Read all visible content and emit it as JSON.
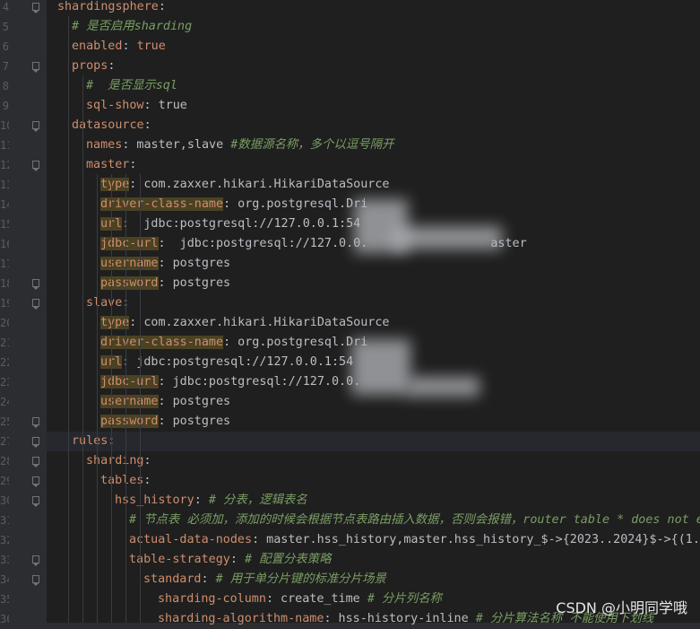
{
  "editor": {
    "lines": [
      {
        "num": "4",
        "fold": true,
        "indent": 0,
        "parts": [
          {
            "t": "shardingsphere",
            "c": "k"
          },
          {
            "t": ":",
            "c": "v"
          }
        ]
      },
      {
        "num": "5",
        "fold": false,
        "indent": 1,
        "parts": [
          {
            "t": "# 是否启用sharding",
            "c": "c"
          }
        ]
      },
      {
        "num": "6",
        "fold": false,
        "indent": 1,
        "parts": [
          {
            "t": "enabled",
            "c": "k"
          },
          {
            "t": ": ",
            "c": "v"
          },
          {
            "t": "true",
            "c": "k"
          }
        ]
      },
      {
        "num": "7",
        "fold": true,
        "indent": 1,
        "parts": [
          {
            "t": "props",
            "c": "k"
          },
          {
            "t": ":",
            "c": "v"
          }
        ]
      },
      {
        "num": "8",
        "fold": false,
        "indent": 2,
        "parts": [
          {
            "t": "#  是否显示sql",
            "c": "c"
          }
        ]
      },
      {
        "num": "9",
        "fold": false,
        "indent": 2,
        "parts": [
          {
            "t": "sql-show",
            "c": "k"
          },
          {
            "t": ": true",
            "c": "v"
          }
        ]
      },
      {
        "num": "10",
        "fold": true,
        "indent": 1,
        "parts": [
          {
            "t": "datasource",
            "c": "k"
          },
          {
            "t": ":",
            "c": "v"
          }
        ]
      },
      {
        "num": "11",
        "fold": false,
        "indent": 2,
        "parts": [
          {
            "t": "names",
            "c": "k"
          },
          {
            "t": ": master,slave ",
            "c": "v"
          },
          {
            "t": "#数据源名称，多个以逗号隔开",
            "c": "c"
          }
        ]
      },
      {
        "num": "12",
        "fold": true,
        "indent": 2,
        "parts": [
          {
            "t": "master",
            "c": "k"
          },
          {
            "t": ":",
            "c": "v"
          }
        ]
      },
      {
        "num": "13",
        "fold": false,
        "indent": 3,
        "parts": [
          {
            "t": "type",
            "c": "kh"
          },
          {
            "t": ": com.zaxxer.hikari.HikariDataSource",
            "c": "v"
          }
        ]
      },
      {
        "num": "14",
        "fold": false,
        "indent": 3,
        "parts": [
          {
            "t": "driver-class-name",
            "c": "kh"
          },
          {
            "t": ": org.postgresql.Dri",
            "c": "v"
          }
        ]
      },
      {
        "num": "15",
        "fold": false,
        "indent": 3,
        "parts": [
          {
            "t": "url",
            "c": "kh"
          },
          {
            "t": ":  jdbc:postgresql://127.0.0.1:54",
            "c": "v"
          }
        ]
      },
      {
        "num": "16",
        "fold": false,
        "indent": 3,
        "parts": [
          {
            "t": "jdbc-url",
            "c": "kh"
          },
          {
            "t": ":  jdbc:postgresql://127.0.0.                 aster",
            "c": "v"
          }
        ]
      },
      {
        "num": "17",
        "fold": false,
        "indent": 3,
        "parts": [
          {
            "t": "username",
            "c": "kh"
          },
          {
            "t": ": postgres",
            "c": "v"
          }
        ]
      },
      {
        "num": "18",
        "fold": true,
        "indent": 3,
        "parts": [
          {
            "t": "password",
            "c": "kh"
          },
          {
            "t": ": postgres",
            "c": "v"
          }
        ]
      },
      {
        "num": "19",
        "fold": true,
        "indent": 2,
        "parts": [
          {
            "t": "slave",
            "c": "k"
          },
          {
            "t": ":",
            "c": "v"
          }
        ]
      },
      {
        "num": "20",
        "fold": false,
        "indent": 3,
        "parts": [
          {
            "t": "type",
            "c": "kh"
          },
          {
            "t": ": com.zaxxer.hikari.HikariDataSource",
            "c": "v"
          }
        ]
      },
      {
        "num": "21",
        "fold": false,
        "indent": 3,
        "parts": [
          {
            "t": "driver-class-name",
            "c": "kh"
          },
          {
            "t": ": org.postgresql.Dri",
            "c": "v"
          }
        ]
      },
      {
        "num": "22",
        "fold": false,
        "indent": 3,
        "parts": [
          {
            "t": "url",
            "c": "kh"
          },
          {
            "t": ": jdbc:postgresql://127.0.0.1:54",
            "c": "v"
          }
        ]
      },
      {
        "num": "23",
        "fold": false,
        "indent": 3,
        "parts": [
          {
            "t": "jdbc-url",
            "c": "kh"
          },
          {
            "t": ": jdbc:postgresql://127.0.0.",
            "c": "v"
          }
        ]
      },
      {
        "num": "24",
        "fold": false,
        "indent": 3,
        "parts": [
          {
            "t": "username",
            "c": "kh"
          },
          {
            "t": ": postgres",
            "c": "v"
          }
        ]
      },
      {
        "num": "25",
        "fold": true,
        "indent": 3,
        "parts": [
          {
            "t": "password",
            "c": "kh"
          },
          {
            "t": ": postgres",
            "c": "v"
          }
        ]
      },
      {
        "num": "27",
        "fold": true,
        "indent": 1,
        "current": true,
        "parts": [
          {
            "t": "rules",
            "c": "k"
          },
          {
            "t": ":",
            "c": "v"
          }
        ]
      },
      {
        "num": "28",
        "fold": true,
        "indent": 2,
        "parts": [
          {
            "t": "sharding",
            "c": "k"
          },
          {
            "t": ":",
            "c": "v"
          }
        ]
      },
      {
        "num": "29",
        "fold": true,
        "indent": 3,
        "parts": [
          {
            "t": "tables",
            "c": "k"
          },
          {
            "t": ":",
            "c": "v"
          }
        ]
      },
      {
        "num": "30",
        "fold": true,
        "indent": 4,
        "parts": [
          {
            "t": "hss_history",
            "c": "k"
          },
          {
            "t": ": ",
            "c": "v"
          },
          {
            "t": "# 分表，逻辑表名",
            "c": "c"
          }
        ]
      },
      {
        "num": "31",
        "fold": false,
        "indent": 5,
        "parts": [
          {
            "t": "# 节点表 必须加，添加的时候会根据节点表路由插入数据，否则会报错，router table * does not exi",
            "c": "c"
          }
        ]
      },
      {
        "num": "32",
        "fold": false,
        "indent": 5,
        "parts": [
          {
            "t": "actual-data-nodes",
            "c": "k"
          },
          {
            "t": ": master.hss_history,master.hss_history_$->{2023..2024}$->{(1..",
            "c": "v"
          }
        ]
      },
      {
        "num": "33",
        "fold": true,
        "indent": 5,
        "parts": [
          {
            "t": "table-strategy",
            "c": "k"
          },
          {
            "t": ": ",
            "c": "v"
          },
          {
            "t": "# 配置分表策略",
            "c": "c"
          }
        ]
      },
      {
        "num": "34",
        "fold": true,
        "indent": 6,
        "parts": [
          {
            "t": "standard",
            "c": "k"
          },
          {
            "t": ": ",
            "c": "v"
          },
          {
            "t": "# 用于单分片键的标准分片场景",
            "c": "c"
          }
        ]
      },
      {
        "num": "35",
        "fold": false,
        "indent": 7,
        "parts": [
          {
            "t": "sharding-column",
            "c": "k"
          },
          {
            "t": ": create_time ",
            "c": "v"
          },
          {
            "t": "# 分片列名称",
            "c": "c"
          }
        ]
      },
      {
        "num": "36",
        "fold": false,
        "indent": 7,
        "parts": [
          {
            "t": "sharding-algorithm-name",
            "c": "k"
          },
          {
            "t": ": hss-history-inline ",
            "c": "v"
          },
          {
            "t": "# 分片算法名称 不能使用下划线",
            "c": "c"
          }
        ]
      }
    ]
  },
  "watermark": "CSDN @小明同学哦",
  "colors": {
    "key": "#cf8e6d",
    "comment": "#7a9e64",
    "text": "#bcbec4",
    "background": "#1f1f1f"
  }
}
